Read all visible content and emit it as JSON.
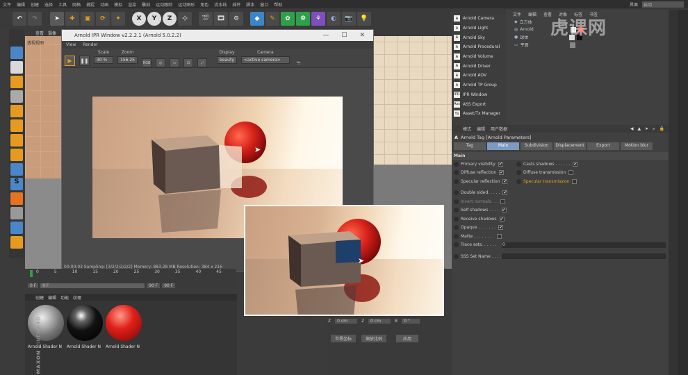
{
  "menubar": {
    "items": [
      "文件",
      "编辑",
      "创建",
      "选择",
      "工具",
      "网格",
      "捕捉",
      "动画",
      "模拟",
      "渲染",
      "雕刻",
      "运动跟踪",
      "运动图形",
      "角色",
      "流水线",
      "插件",
      "脚本",
      "窗口",
      "帮助"
    ],
    "layout_label": "界面",
    "layout_value": "启动"
  },
  "viewport": {
    "tabs": [
      "查看",
      "摄像"
    ],
    "label": "透视视图"
  },
  "ipr": {
    "title": "Arnold IPR Window v2.2.2.1 (Arnold 5.0.2.2)",
    "menu": [
      "View",
      "Render"
    ],
    "scale_label": "Scale",
    "scale_value": "30 %",
    "zoom_label": "Zoom",
    "zoom_value": "156.25",
    "rgb_label": "RGB",
    "display_label": "Display",
    "display_value": "beauty",
    "camera_label": "Camera",
    "camera_value": "<active camera>",
    "status": "00:00:03  Sampling: [3/2/2/2/2/2]  Memory: 883.28 MB  Resolution: 384 x 216"
  },
  "timeline": {
    "ticks": [
      "0",
      "5",
      "10",
      "15",
      "20",
      "25",
      "30",
      "35",
      "40",
      "45"
    ],
    "start": "0 F",
    "current": "0 F",
    "end_field": "90 F",
    "end": "90 F"
  },
  "materials": {
    "menu": [
      "创建",
      "编辑",
      "功能",
      "纹理"
    ],
    "items": [
      {
        "label": "Arnold Shader N"
      },
      {
        "label": "Arnold Shader N"
      },
      {
        "label": "Arnold Shader N"
      }
    ],
    "brand_line1": "MAXON",
    "brand_line2": "CINEMA4D"
  },
  "coords": {
    "row1": [
      "Z",
      "0 cm",
      "Z",
      "0 cm",
      "B",
      "0 °"
    ],
    "dropdown1": "世界坐标",
    "dropdown2": "缩放比例",
    "apply": "应用"
  },
  "right_menu": {
    "items": [
      {
        "icon": "A",
        "label": "Arnold Camera"
      },
      {
        "icon": "A",
        "label": "Arnold Light"
      },
      {
        "icon": "A",
        "label": "Arnold Sky"
      },
      {
        "icon": "A",
        "label": "Arnold Procedural"
      },
      {
        "icon": "A",
        "label": "Arnold Volume"
      },
      {
        "icon": "A",
        "label": "Arnold Driver"
      },
      {
        "icon": "A",
        "label": "Arnold AOV"
      },
      {
        "icon": "A",
        "label": "Arnold TP Group"
      },
      {
        "icon": "IPR",
        "label": "IPR Window"
      },
      {
        "icon": "Ass",
        "label": "ASS Export"
      },
      {
        "icon": "Tx",
        "label": "Asset/Tx Manager"
      }
    ]
  },
  "object_manager": {
    "menu": [
      "文件",
      "编辑",
      "查看",
      "对象",
      "标签",
      "书签"
    ],
    "objects": [
      "立方体",
      "Arnold",
      "球体",
      "平面"
    ]
  },
  "watermark": "虎课网",
  "attributes": {
    "menu": [
      "模式",
      "编辑",
      "用户数据"
    ],
    "title": "Arnold Tag [Arnold Parameters]",
    "tabs": [
      "Tag",
      "Main",
      "Subdivision",
      "Displacement",
      "Export",
      "Motion blur"
    ],
    "section": "Main",
    "left_col": [
      {
        "label": "Primary visibility",
        "checked": "✔"
      },
      {
        "label": "Diffuse reflection",
        "checked": "✔"
      },
      {
        "label": "Specular reflection",
        "checked": "✔"
      }
    ],
    "right_col": [
      {
        "label": "Casts shadows . . . . . .",
        "checked": "✔"
      },
      {
        "label": "Diffuse transmission",
        "checked": ""
      },
      {
        "label": "Specular transmission",
        "checked": ""
      }
    ],
    "props": [
      {
        "label": "Double sided. . . . .",
        "checked": "✔"
      },
      {
        "label": "Invert normals. . .",
        "checked": ""
      },
      {
        "label": "Self shadows . . . .",
        "checked": "✔"
      },
      {
        "label": "Receive shadows",
        "checked": "✔"
      },
      {
        "label": "Opaque . . . . . . .",
        "checked": "✔"
      },
      {
        "label": "Matte . . . . . . . .",
        "checked": ""
      }
    ],
    "trace_label": "Trace sets. . . . . .",
    "trace_value": "0",
    "sss_label": "SSS Set Name . . . ."
  },
  "colors": {
    "accent": "#e69b20",
    "active_tab": "#7d9ac0",
    "highlight_text": "#e6a020"
  }
}
